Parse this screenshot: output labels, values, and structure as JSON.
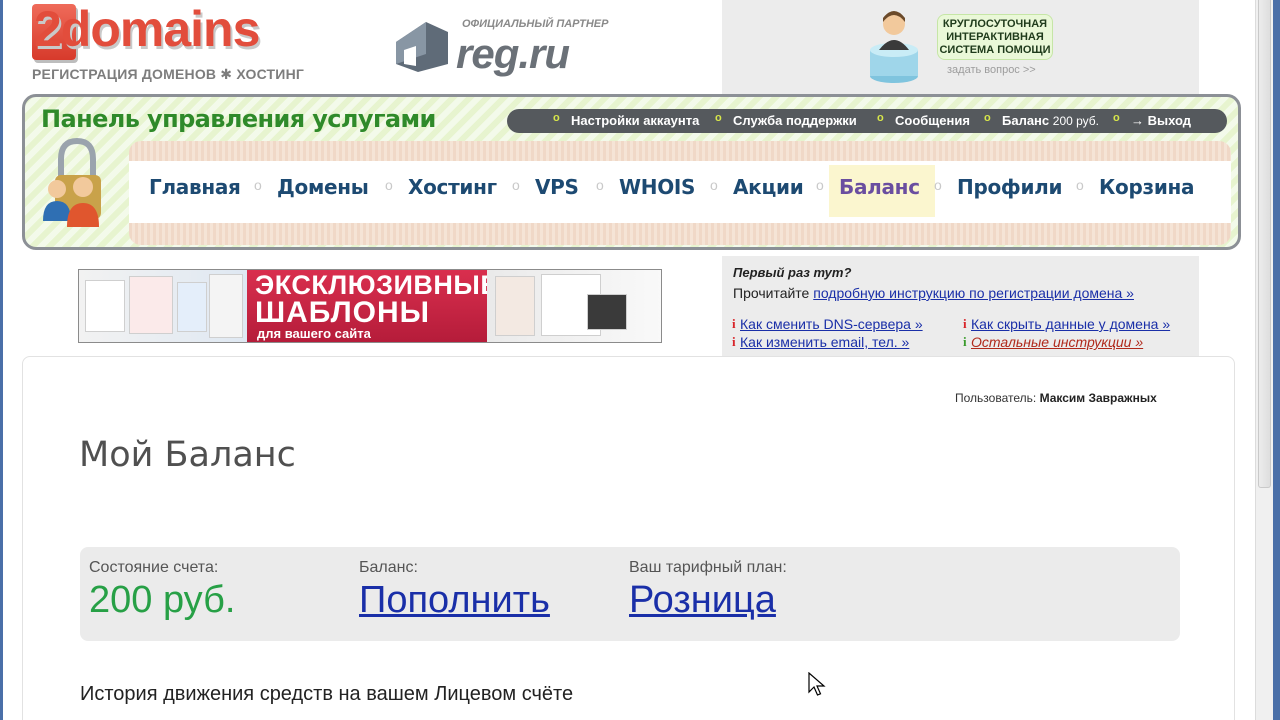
{
  "header": {
    "logo_text_main": "2domains",
    "logo_subtitle": "РЕГИСТРАЦИЯ ДОМЕНОВ ✱ ХОСТИНГ",
    "partner_caption": "ОФИЦИАЛЬНЫЙ ПАРТНЕР",
    "partner_name": "reg.ru",
    "help_line1": "КРУГЛОСУТОЧНАЯ",
    "help_line2": "ИНТЕРАКТИВНАЯ",
    "help_line3": "СИСТЕМА ПОМОЩИ",
    "help_ask": "задать вопрос >>"
  },
  "panel": {
    "title": "Панель управления услугами",
    "account_bar": {
      "settings": "Настройки аккаунта",
      "support": "Служба поддержки",
      "messages": "Сообщения",
      "balance_label": "Баланс",
      "balance_value": "200 руб.",
      "logout": "→ Выход"
    },
    "nav": [
      "Главная",
      "Домены",
      "Хостинг",
      "VPS",
      "WHOIS",
      "Акции",
      "Баланс",
      "Профили",
      "Корзина"
    ],
    "active_nav": "Баланс"
  },
  "banner": {
    "line1": "ЭКСКЛЮЗИВНЫЕ",
    "line2": "ШАБЛОНЫ",
    "line3": "для вашего сайта"
  },
  "firsttime": {
    "question": "Первый раз тут?",
    "read_prefix": "Прочитайте",
    "read_link": "подробную инструкцию по регистрации домена »",
    "links": {
      "dns": "Как сменить DNS-сервера »",
      "hide": "Как скрыть данные у домена »",
      "email": "Как изменить email, тел. »",
      "other": "Остальные инструкции »"
    },
    "info_glyph": "i"
  },
  "content": {
    "user_label": "Пользователь:",
    "user_name": "Максим Завражных",
    "page_title": "Мой Баланс",
    "account_state_label": "Состояние счета:",
    "account_state_value": "200 руб.",
    "balance_label": "Баланс:",
    "balance_link": "Пополнить",
    "plan_label": "Ваш тарифный план:",
    "plan_link": "Розница",
    "history_title": "История движения средств на вашем Лицевом счёте"
  },
  "colors": {
    "green_title": "#2f8a2a",
    "nav_blue": "#1d4a72",
    "link_blue": "#1a2fa8",
    "balance_green": "#27a046",
    "logo_red": "#e24d3c"
  }
}
